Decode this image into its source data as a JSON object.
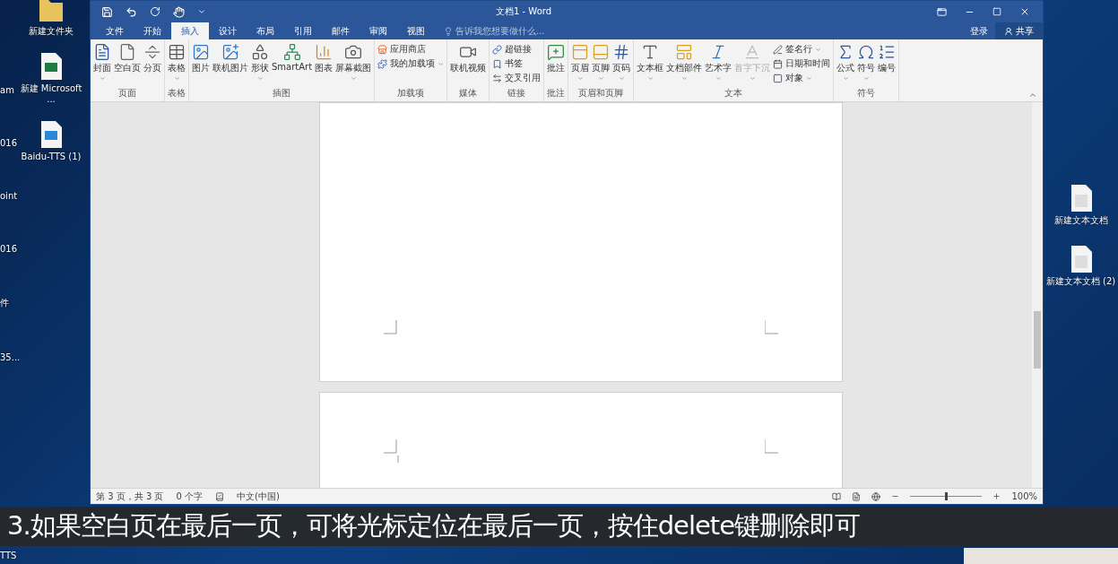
{
  "desktop_left": {
    "partial_labels": [
      "am",
      "016",
      "oint",
      "016",
      "件",
      "35..."
    ],
    "icons": [
      {
        "label": "新建文件夹",
        "kind": "folder"
      },
      {
        "label": "新建 Microsoft ...",
        "kind": "excel"
      },
      {
        "label": "Baidu-TTS (1)",
        "kind": "audio"
      }
    ]
  },
  "window": {
    "title": "文档1 - Word"
  },
  "tabs": [
    {
      "label": "文件",
      "selected": false
    },
    {
      "label": "开始",
      "selected": false
    },
    {
      "label": "插入",
      "selected": true
    },
    {
      "label": "设计",
      "selected": false
    },
    {
      "label": "布局",
      "selected": false
    },
    {
      "label": "引用",
      "selected": false
    },
    {
      "label": "邮件",
      "selected": false
    },
    {
      "label": "审阅",
      "selected": false
    },
    {
      "label": "视图",
      "selected": false
    }
  ],
  "tell_me": {
    "placeholder": "告诉我您想要做什么..."
  },
  "account": {
    "sign_in": "登录",
    "share": "共享"
  },
  "ribbon_groups": [
    {
      "label": "页面",
      "items": [
        {
          "kind": "large",
          "label": "封面",
          "caret": true,
          "disabled": false
        },
        {
          "kind": "large",
          "label": "空白页",
          "caret": false,
          "disabled": false
        },
        {
          "kind": "large",
          "label": "分页",
          "caret": false,
          "disabled": false
        }
      ]
    },
    {
      "label": "表格",
      "items": [
        {
          "kind": "large",
          "label": "表格",
          "caret": true,
          "disabled": false
        }
      ]
    },
    {
      "label": "插图",
      "items": [
        {
          "kind": "large",
          "label": "图片",
          "caret": false,
          "disabled": false
        },
        {
          "kind": "large",
          "label": "联机图片",
          "caret": false,
          "disabled": false
        },
        {
          "kind": "large",
          "label": "形状",
          "caret": true,
          "disabled": false
        },
        {
          "kind": "large",
          "label": "SmartArt",
          "caret": false,
          "disabled": false
        },
        {
          "kind": "large",
          "label": "图表",
          "caret": false,
          "disabled": false
        },
        {
          "kind": "large",
          "label": "屏幕截图",
          "caret": true,
          "disabled": false
        }
      ]
    },
    {
      "label": "加载项",
      "items": [
        {
          "kind": "small",
          "label": "应用商店",
          "caret": false,
          "disabled": false
        },
        {
          "kind": "small",
          "label": "我的加载项",
          "caret": true,
          "disabled": false
        }
      ]
    },
    {
      "label": "媒体",
      "items": [
        {
          "kind": "large",
          "label": "联机视频",
          "caret": false,
          "disabled": false
        }
      ]
    },
    {
      "label": "链接",
      "items": [
        {
          "kind": "small",
          "label": "超链接",
          "caret": false,
          "disabled": false
        },
        {
          "kind": "small",
          "label": "书签",
          "caret": false,
          "disabled": false
        },
        {
          "kind": "small",
          "label": "交叉引用",
          "caret": false,
          "disabled": false
        }
      ]
    },
    {
      "label": "批注",
      "items": [
        {
          "kind": "large",
          "label": "批注",
          "caret": false,
          "disabled": false
        }
      ]
    },
    {
      "label": "页眉和页脚",
      "items": [
        {
          "kind": "large",
          "label": "页眉",
          "caret": true,
          "disabled": false
        },
        {
          "kind": "large",
          "label": "页脚",
          "caret": true,
          "disabled": false
        },
        {
          "kind": "large",
          "label": "页码",
          "caret": true,
          "disabled": false
        }
      ]
    },
    {
      "label": "文本",
      "items": [
        {
          "kind": "large",
          "label": "文本框",
          "caret": true,
          "disabled": false
        },
        {
          "kind": "large",
          "label": "文档部件",
          "caret": true,
          "disabled": false
        },
        {
          "kind": "large",
          "label": "艺术字",
          "caret": true,
          "disabled": false
        },
        {
          "kind": "large",
          "label": "首字下沉",
          "caret": true,
          "disabled": true
        },
        {
          "kind": "small",
          "label": "签名行",
          "caret": true,
          "disabled": false
        },
        {
          "kind": "small",
          "label": "日期和时间",
          "caret": false,
          "disabled": false
        },
        {
          "kind": "small",
          "label": "对象",
          "caret": true,
          "disabled": false
        }
      ]
    },
    {
      "label": "符号",
      "items": [
        {
          "kind": "large",
          "label": "公式",
          "caret": true,
          "disabled": false
        },
        {
          "kind": "large",
          "label": "符号",
          "caret": true,
          "disabled": false
        },
        {
          "kind": "large",
          "label": "编号",
          "caret": false,
          "disabled": false
        }
      ]
    }
  ],
  "status_bar": {
    "page": "第 3 页，共 3 页",
    "words": "0 个字",
    "language": "中文(中国)",
    "zoom": {
      "level": 0.5,
      "reading": "100%"
    }
  },
  "desktop_right": {
    "icons": [
      {
        "label": "新建文本文档",
        "kind": "text"
      },
      {
        "label": "新建文本文档 (2)",
        "kind": "text"
      }
    ]
  },
  "subtitle": "3.如果空白页在最后一页，可将光标定位在最后一页，按住delete键删除即可",
  "desktop_bottom": {
    "partial_label": "TTS"
  }
}
